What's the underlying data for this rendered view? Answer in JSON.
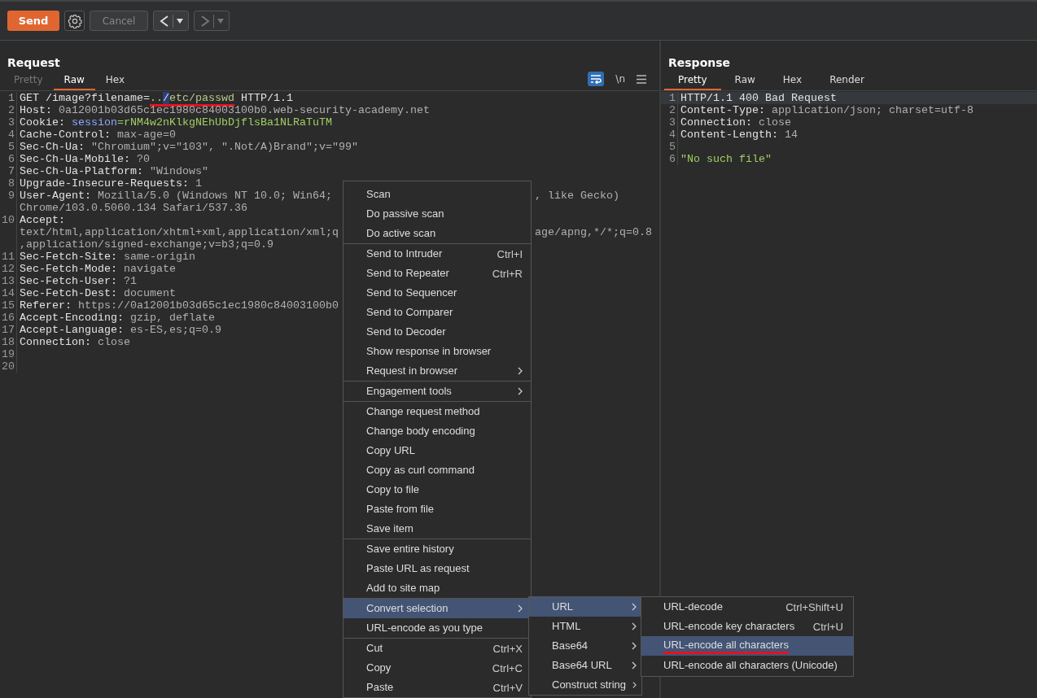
{
  "toolbar": {
    "send": "Send",
    "cancel": {
      "label": "Cancel",
      "disabled": true
    },
    "nav": [
      {
        "kind": "back",
        "disabled": false
      },
      {
        "kind": "forward",
        "disabled": true
      }
    ]
  },
  "request": {
    "title": "Request",
    "tabs": [
      {
        "label": "Pretty",
        "selected": false,
        "disabled": true
      },
      {
        "label": "Raw",
        "selected": true,
        "disabled": false
      },
      {
        "label": "Hex",
        "selected": false,
        "disabled": false
      }
    ],
    "wrap_on": true,
    "newline_toggle": "\\n",
    "lines": [
      {
        "num": "1",
        "rows": [
          {
            "segments": [
              {
                "text": "GET /image?filename=",
                "kind": "name"
              },
              {
                "text": "..",
                "kind": "param",
                "underlined": true
              },
              {
                "text": "/",
                "kind": "selected",
                "underlined": true
              },
              {
                "text": "etc/passwd",
                "kind": "param",
                "underlined": true
              },
              {
                "text": " HTTP/1.1",
                "kind": "name"
              }
            ]
          }
        ]
      },
      {
        "num": "2",
        "rows": [
          {
            "segments": [
              {
                "text": "Host: ",
                "kind": "name"
              },
              {
                "text": "0a12001b03d65c1ec1980c84003100b0.web-security-academy.net",
                "kind": "value"
              }
            ]
          }
        ]
      },
      {
        "num": "3",
        "rows": [
          {
            "segments": [
              {
                "text": "Cookie: ",
                "kind": "name"
              },
              {
                "text": "session",
                "kind": "cookie"
              },
              {
                "text": "=rNM4w2nKlkgNEhUbDjflsBa1NLRaTuTM",
                "kind": "string"
              }
            ]
          }
        ]
      },
      {
        "num": "4",
        "rows": [
          {
            "segments": [
              {
                "text": "Cache-Control: ",
                "kind": "name"
              },
              {
                "text": "max-age=0",
                "kind": "value"
              }
            ]
          }
        ]
      },
      {
        "num": "5",
        "rows": [
          {
            "segments": [
              {
                "text": "Sec-Ch-Ua: ",
                "kind": "name"
              },
              {
                "text": "\"Chromium\";v=\"103\", \".Not/A)Brand\";v=\"99\"",
                "kind": "value"
              }
            ]
          }
        ]
      },
      {
        "num": "6",
        "rows": [
          {
            "segments": [
              {
                "text": "Sec-Ch-Ua-Mobile: ",
                "kind": "name"
              },
              {
                "text": "?0",
                "kind": "value"
              }
            ]
          }
        ]
      },
      {
        "num": "7",
        "rows": [
          {
            "segments": [
              {
                "text": "Sec-Ch-Ua-Platform: ",
                "kind": "name"
              },
              {
                "text": "\"Windows\"",
                "kind": "value"
              }
            ]
          }
        ]
      },
      {
        "num": "8",
        "rows": [
          {
            "segments": [
              {
                "text": "Upgrade-Insecure-Requests: ",
                "kind": "name"
              },
              {
                "text": "1",
                "kind": "value"
              }
            ]
          }
        ]
      },
      {
        "num": "9",
        "rows": [
          {
            "segments": [
              {
                "text": "User-Agent: ",
                "kind": "name"
              },
              {
                "text": "Mozilla/5.0 (Windows NT 10.0; Win64;",
                "kind": "value"
              }
            ],
            "tail": ", like Gecko)"
          },
          {
            "segments": [
              {
                "text": "Chrome/103.0.5060.134 Safari/537.36",
                "kind": "value"
              }
            ]
          }
        ]
      },
      {
        "num": "10",
        "rows": [
          {
            "segments": [
              {
                "text": "Accept: ",
                "kind": "name"
              }
            ]
          },
          {
            "segments": [
              {
                "text": "text/html,application/xhtml+xml,application/xml;q",
                "kind": "value"
              }
            ],
            "tail": "age/apng,*/*;q=0.8"
          },
          {
            "segments": [
              {
                "text": ",application/signed-exchange;v=b3;q=0.9",
                "kind": "value"
              }
            ]
          }
        ]
      },
      {
        "num": "11",
        "rows": [
          {
            "segments": [
              {
                "text": "Sec-Fetch-Site: ",
                "kind": "name"
              },
              {
                "text": "same-origin",
                "kind": "value"
              }
            ]
          }
        ]
      },
      {
        "num": "12",
        "rows": [
          {
            "segments": [
              {
                "text": "Sec-Fetch-Mode: ",
                "kind": "name"
              },
              {
                "text": "navigate",
                "kind": "value"
              }
            ]
          }
        ]
      },
      {
        "num": "13",
        "rows": [
          {
            "segments": [
              {
                "text": "Sec-Fetch-User: ",
                "kind": "name"
              },
              {
                "text": "?1",
                "kind": "value"
              }
            ]
          }
        ]
      },
      {
        "num": "14",
        "rows": [
          {
            "segments": [
              {
                "text": "Sec-Fetch-Dest: ",
                "kind": "name"
              },
              {
                "text": "document",
                "kind": "value"
              }
            ]
          }
        ]
      },
      {
        "num": "15",
        "rows": [
          {
            "segments": [
              {
                "text": "Referer: ",
                "kind": "name"
              },
              {
                "text": "https://0a12001b03d65c1ec1980c84003100b0",
                "kind": "value"
              }
            ]
          }
        ]
      },
      {
        "num": "16",
        "rows": [
          {
            "segments": [
              {
                "text": "Accept-Encoding: ",
                "kind": "name"
              },
              {
                "text": "gzip, deflate",
                "kind": "value"
              }
            ]
          }
        ]
      },
      {
        "num": "17",
        "rows": [
          {
            "segments": [
              {
                "text": "Accept-Language: ",
                "kind": "name"
              },
              {
                "text": "es-ES,es;q=0.9",
                "kind": "value"
              }
            ]
          }
        ]
      },
      {
        "num": "18",
        "rows": [
          {
            "segments": [
              {
                "text": "Connection: ",
                "kind": "name"
              },
              {
                "text": "close",
                "kind": "value"
              }
            ]
          }
        ]
      },
      {
        "num": "19",
        "rows": [
          {
            "segments": []
          }
        ]
      },
      {
        "num": "20",
        "rows": [
          {
            "segments": []
          }
        ]
      }
    ]
  },
  "response": {
    "title": "Response",
    "tabs": [
      {
        "label": "Pretty",
        "selected": true,
        "disabled": false
      },
      {
        "label": "Raw",
        "selected": false,
        "disabled": false
      },
      {
        "label": "Hex",
        "selected": false,
        "disabled": false
      },
      {
        "label": "Render",
        "selected": false,
        "disabled": false
      }
    ],
    "lines": [
      {
        "num": "1",
        "current": true,
        "rows": [
          {
            "segments": [
              {
                "text": "HTTP/1.1 400 Bad Request",
                "kind": "name"
              }
            ]
          }
        ]
      },
      {
        "num": "2",
        "current": false,
        "rows": [
          {
            "segments": [
              {
                "text": "Content-Type: ",
                "kind": "name"
              },
              {
                "text": "application/json; charset=utf-8",
                "kind": "value"
              }
            ]
          }
        ]
      },
      {
        "num": "3",
        "current": false,
        "rows": [
          {
            "segments": [
              {
                "text": "Connection: ",
                "kind": "name"
              },
              {
                "text": "close",
                "kind": "value"
              }
            ]
          }
        ]
      },
      {
        "num": "4",
        "current": false,
        "rows": [
          {
            "segments": [
              {
                "text": "Content-Length: ",
                "kind": "name"
              },
              {
                "text": "14",
                "kind": "value"
              }
            ]
          }
        ]
      },
      {
        "num": "5",
        "current": false,
        "rows": [
          {
            "segments": []
          }
        ]
      },
      {
        "num": "6",
        "current": false,
        "rows": [
          {
            "segments": [
              {
                "text": "\"No such file\"",
                "kind": "string"
              }
            ]
          }
        ]
      }
    ]
  },
  "context_menu": {
    "groups": [
      {
        "items": [
          {
            "label": "Scan",
            "submenu": false,
            "selected": false
          },
          {
            "label": "Do passive scan",
            "submenu": false,
            "selected": false
          },
          {
            "label": "Do active scan",
            "submenu": false,
            "selected": false
          }
        ]
      },
      {
        "items": [
          {
            "label": "Send to Intruder",
            "shortcut": "Ctrl+I",
            "submenu": false,
            "selected": false
          },
          {
            "label": "Send to Repeater",
            "shortcut": "Ctrl+R",
            "submenu": false,
            "selected": false
          },
          {
            "label": "Send to Sequencer",
            "submenu": false,
            "selected": false
          },
          {
            "label": "Send to Comparer",
            "submenu": false,
            "selected": false
          },
          {
            "label": "Send to Decoder",
            "submenu": false,
            "selected": false
          },
          {
            "label": "Show response in browser",
            "submenu": false,
            "selected": false
          },
          {
            "label": "Request in browser",
            "submenu": true,
            "selected": false
          }
        ]
      },
      {
        "items": [
          {
            "label": "Engagement tools",
            "submenu": true,
            "selected": false
          }
        ]
      },
      {
        "items": [
          {
            "label": "Change request method",
            "submenu": false,
            "selected": false
          },
          {
            "label": "Change body encoding",
            "submenu": false,
            "selected": false
          },
          {
            "label": "Copy URL",
            "submenu": false,
            "selected": false
          },
          {
            "label": "Copy as curl command",
            "submenu": false,
            "selected": false
          },
          {
            "label": "Copy to file",
            "submenu": false,
            "selected": false
          },
          {
            "label": "Paste from file",
            "submenu": false,
            "selected": false
          },
          {
            "label": "Save item",
            "submenu": false,
            "selected": false
          }
        ]
      },
      {
        "items": [
          {
            "label": "Save entire history",
            "submenu": false,
            "selected": false
          },
          {
            "label": "Paste URL as request",
            "submenu": false,
            "selected": false
          },
          {
            "label": "Add to site map",
            "submenu": false,
            "selected": false
          }
        ]
      },
      {
        "items": [
          {
            "label": "Convert selection",
            "submenu": true,
            "selected": true
          },
          {
            "label": "URL-encode as you type",
            "submenu": false,
            "selected": false
          }
        ]
      },
      {
        "items": [
          {
            "label": "Cut",
            "shortcut": "Ctrl+X",
            "submenu": false,
            "selected": false
          },
          {
            "label": "Copy",
            "shortcut": "Ctrl+C",
            "submenu": false,
            "selected": false
          },
          {
            "label": "Paste",
            "shortcut": "Ctrl+V",
            "submenu": false,
            "selected": false
          }
        ]
      }
    ]
  },
  "submenus": [
    {
      "items": [
        {
          "label": "URL",
          "submenu": true,
          "selected": true
        },
        {
          "label": "HTML",
          "submenu": true,
          "selected": false
        },
        {
          "label": "Base64",
          "submenu": true,
          "selected": false
        },
        {
          "label": "Base64 URL",
          "submenu": true,
          "selected": false
        },
        {
          "label": "Construct string",
          "submenu": true,
          "selected": false
        }
      ]
    },
    {
      "items": [
        {
          "label": "URL-decode",
          "shortcut": "Ctrl+Shift+U",
          "selected": false
        },
        {
          "label": "URL-encode key characters",
          "shortcut": "Ctrl+U",
          "selected": false
        },
        {
          "label": "URL-encode all characters",
          "selected": true,
          "underlined": true
        },
        {
          "label": "URL-encode all characters (Unicode)",
          "selected": false
        }
      ]
    }
  ]
}
